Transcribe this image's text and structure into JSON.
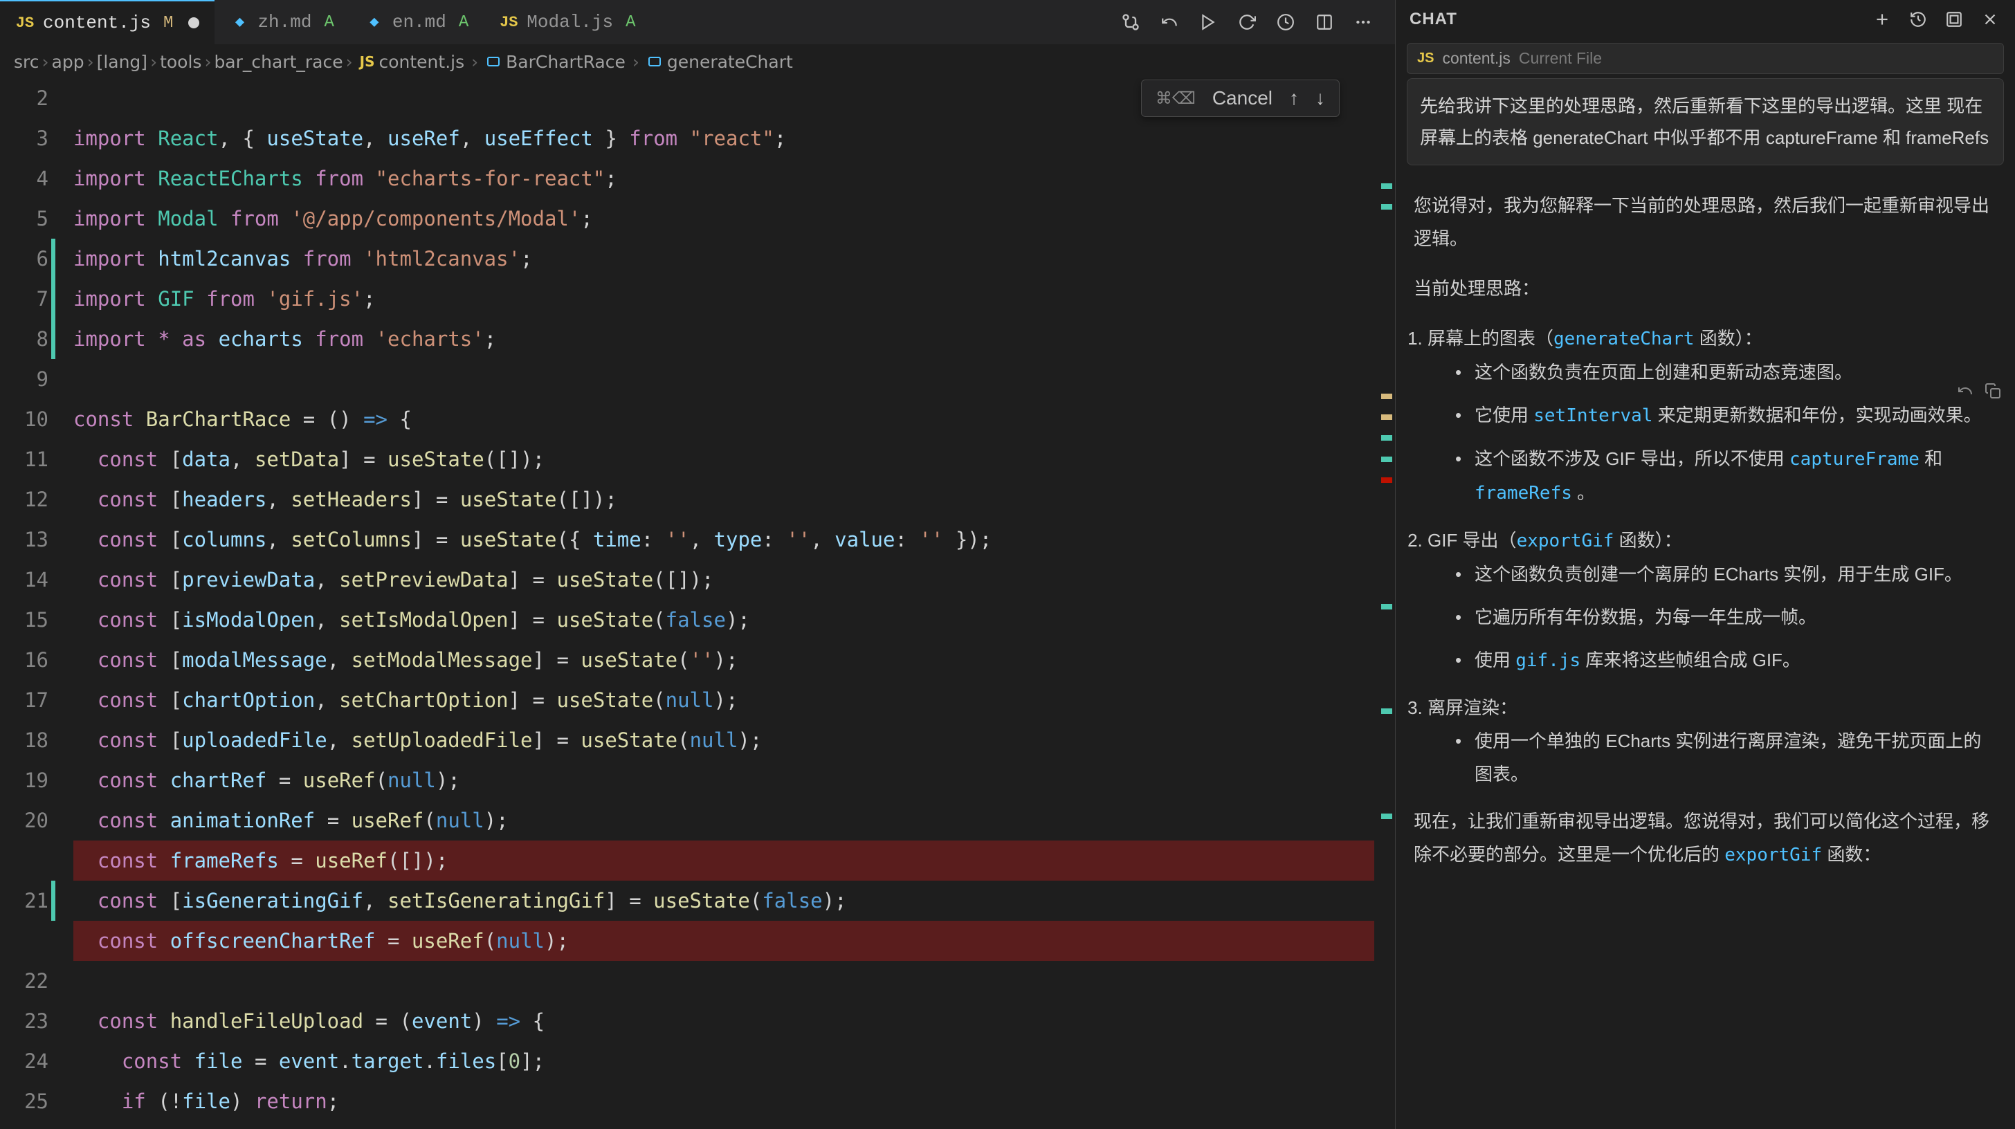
{
  "tabs": [
    {
      "name": "content.js",
      "status": "M",
      "active": true,
      "icon": "js"
    },
    {
      "name": "zh.md",
      "status": "A",
      "active": false,
      "icon": "md"
    },
    {
      "name": "en.md",
      "status": "A",
      "active": false,
      "icon": "md"
    },
    {
      "name": "Modal.js",
      "status": "A",
      "active": false,
      "icon": "js"
    }
  ],
  "breadcrumb": {
    "parts": [
      "src",
      "app",
      "[lang]",
      "tools",
      "bar_chart_race"
    ],
    "file": "content.js",
    "symbols": [
      "BarChartRace",
      "generateChart"
    ]
  },
  "find_widget": {
    "shortcut": "⌘⌫",
    "label": "Cancel"
  },
  "code_lines": [
    {
      "n": 2,
      "html": ""
    },
    {
      "n": 3,
      "html": "<span class='kw'>import</span> <span class='type'>React</span><span class='punc'>,</span> <span class='punc'>{</span> <span class='var'>useState</span><span class='punc'>,</span> <span class='var'>useRef</span><span class='punc'>,</span> <span class='var'>useEffect</span> <span class='punc'>}</span> <span class='kw'>from</span> <span class='str'>\"react\"</span><span class='punc'>;</span>"
    },
    {
      "n": 4,
      "html": "<span class='kw'>import</span> <span class='type'>ReactECharts</span> <span class='kw'>from</span> <span class='str'>\"echarts-for-react\"</span><span class='punc'>;</span>"
    },
    {
      "n": 5,
      "html": "<span class='kw'>import</span> <span class='type'>Modal</span> <span class='kw'>from</span> <span class='str'>'@/app/components/Modal'</span><span class='punc'>;</span>"
    },
    {
      "n": 6,
      "mod": true,
      "html": "<span class='kw'>import</span> <span class='var'>html2canvas</span> <span class='kw'>from</span> <span class='str'>'html2canvas'</span><span class='punc'>;</span>"
    },
    {
      "n": 7,
      "mod": true,
      "html": "<span class='kw'>import</span> <span class='type'>GIF</span> <span class='kw'>from</span> <span class='str'>'gif.js'</span><span class='punc'>;</span>"
    },
    {
      "n": 8,
      "mod": true,
      "html": "<span class='kw'>import</span> <span class='star'>*</span> <span class='kw'>as</span> <span class='var'>echarts</span> <span class='kw'>from</span> <span class='str'>'echarts'</span><span class='punc'>;</span>"
    },
    {
      "n": 9,
      "html": ""
    },
    {
      "n": 10,
      "html": "<span class='kw'>const</span> <span class='fn'>BarChartRace</span> <span class='op'>=</span> <span class='punc'>()</span> <span class='arrow'>=&gt;</span> <span class='punc'>{</span>"
    },
    {
      "n": 11,
      "html": "  <span class='kw'>const</span> <span class='punc'>[</span><span class='var'>data</span><span class='punc'>,</span> <span class='fn'>setData</span><span class='punc'>]</span> <span class='op'>=</span> <span class='fn'>useState</span><span class='punc'>([]);</span>"
    },
    {
      "n": 12,
      "html": "  <span class='kw'>const</span> <span class='punc'>[</span><span class='var'>headers</span><span class='punc'>,</span> <span class='fn'>setHeaders</span><span class='punc'>]</span> <span class='op'>=</span> <span class='fn'>useState</span><span class='punc'>([]);</span>"
    },
    {
      "n": 13,
      "html": "  <span class='kw'>const</span> <span class='punc'>[</span><span class='var'>columns</span><span class='punc'>,</span> <span class='fn'>setColumns</span><span class='punc'>]</span> <span class='op'>=</span> <span class='fn'>useState</span><span class='punc'>({ </span><span class='var'>time</span><span class='punc'>:</span> <span class='str'>''</span><span class='punc'>,</span> <span class='var'>type</span><span class='punc'>:</span> <span class='str'>''</span><span class='punc'>,</span> <span class='var'>value</span><span class='punc'>:</span> <span class='str'>''</span> <span class='punc'>});</span>"
    },
    {
      "n": 14,
      "html": "  <span class='kw'>const</span> <span class='punc'>[</span><span class='var'>previewData</span><span class='punc'>,</span> <span class='fn'>setPreviewData</span><span class='punc'>]</span> <span class='op'>=</span> <span class='fn'>useState</span><span class='punc'>([]);</span>"
    },
    {
      "n": 15,
      "html": "  <span class='kw'>const</span> <span class='punc'>[</span><span class='var'>isModalOpen</span><span class='punc'>,</span> <span class='fn'>setIsModalOpen</span><span class='punc'>]</span> <span class='op'>=</span> <span class='fn'>useState</span><span class='punc'>(</span><span class='bool'>false</span><span class='punc'>);</span>"
    },
    {
      "n": 16,
      "html": "  <span class='kw'>const</span> <span class='punc'>[</span><span class='var'>modalMessage</span><span class='punc'>,</span> <span class='fn'>setModalMessage</span><span class='punc'>]</span> <span class='op'>=</span> <span class='fn'>useState</span><span class='punc'>(</span><span class='str'>''</span><span class='punc'>);</span>"
    },
    {
      "n": 17,
      "html": "  <span class='kw'>const</span> <span class='punc'>[</span><span class='var'>chartOption</span><span class='punc'>,</span> <span class='fn'>setChartOption</span><span class='punc'>]</span> <span class='op'>=</span> <span class='fn'>useState</span><span class='punc'>(</span><span class='bool'>null</span><span class='punc'>);</span>"
    },
    {
      "n": 18,
      "html": "  <span class='kw'>const</span> <span class='punc'>[</span><span class='var'>uploadedFile</span><span class='punc'>,</span> <span class='fn'>setUploadedFile</span><span class='punc'>]</span> <span class='op'>=</span> <span class='fn'>useState</span><span class='punc'>(</span><span class='bool'>null</span><span class='punc'>);</span>"
    },
    {
      "n": 19,
      "html": "  <span class='kw'>const</span> <span class='var'>chartRef</span> <span class='op'>=</span> <span class='fn'>useRef</span><span class='punc'>(</span><span class='bool'>null</span><span class='punc'>);</span>"
    },
    {
      "n": 20,
      "html": "  <span class='kw'>const</span> <span class='var'>animationRef</span> <span class='op'>=</span> <span class='fn'>useRef</span><span class='punc'>(</span><span class='bool'>null</span><span class='punc'>);</span>"
    },
    {
      "n": null,
      "del": true,
      "html": "  <span class='kw'>const</span> <span class='var'>frameRefs</span> <span class='op'>=</span> <span class='fn'>useRef</span><span class='punc'>([]);</span>"
    },
    {
      "n": 21,
      "mod": true,
      "html": "  <span class='kw'>const</span> <span class='punc'>[</span><span class='var'>isGeneratingGif</span><span class='punc'>,</span> <span class='fn'>setIsGeneratingGif</span><span class='punc'>]</span> <span class='op'>=</span> <span class='fn'>useState</span><span class='punc'>(</span><span class='bool'>false</span><span class='punc'>);</span>"
    },
    {
      "n": null,
      "del": true,
      "html": "  <span class='kw'>const</span> <span class='var'>offscreenChartRef</span> <span class='op'>=</span> <span class='fn'>useRef</span><span class='punc'>(</span><span class='bool'>null</span><span class='punc'>);</span>"
    },
    {
      "n": 22,
      "html": ""
    },
    {
      "n": 23,
      "html": "  <span class='kw'>const</span> <span class='fn'>handleFileUpload</span> <span class='op'>=</span> <span class='punc'>(</span><span class='var'>event</span><span class='punc'>)</span> <span class='arrow'>=&gt;</span> <span class='punc'>{</span>"
    },
    {
      "n": 24,
      "html": "    <span class='kw'>const</span> <span class='var'>file</span> <span class='op'>=</span> <span class='var'>event</span><span class='punc'>.</span><span class='var'>target</span><span class='punc'>.</span><span class='var'>files</span><span class='punc'>[</span><span class='num'>0</span><span class='punc'>];</span>"
    },
    {
      "n": 25,
      "html": "    <span class='kw'>if</span> <span class='punc'>(!</span><span class='var'>file</span><span class='punc'>)</span> <span class='kw'>return</span><span class='punc'>;</span>"
    }
  ],
  "chat": {
    "title": "CHAT",
    "context_file": "content.js",
    "context_label": "Current File",
    "user_message": "先给我讲下这里的处理思路，然后重新看下这里的导出逻辑。这里 现在屏幕上的表格 generateChart 中似乎都不用 captureFrame 和 frameRefs",
    "reply_intro": "您说得对，我为您解释一下当前的处理思路，然后我们一起重新审视导出逻辑。",
    "heading_current": "当前处理思路：",
    "sec1_title": "屏幕上的图表（",
    "sec1_code": "generateChart",
    "sec1_title_after": " 函数）：",
    "sec1_b1": "这个函数负责在页面上创建和更新动态竞速图。",
    "sec1_b2_before": "它使用 ",
    "sec1_b2_code": "setInterval",
    "sec1_b2_after": " 来定期更新数据和年份，实现动画效果。",
    "sec1_b3_before": "这个函数不涉及 GIF 导出，所以不使用 ",
    "sec1_b3_code1": "captureFrame",
    "sec1_b3_mid": " 和 ",
    "sec1_b3_code2": "frameRefs",
    "sec1_b3_after": " 。",
    "sec2_title_before": "GIF 导出（",
    "sec2_code": "exportGif",
    "sec2_title_after": " 函数）：",
    "sec2_b1": "这个函数负责创建一个离屏的 ECharts 实例，用于生成 GIF。",
    "sec2_b2": "它遍历所有年份数据，为每一年生成一帧。",
    "sec2_b3_before": "使用 ",
    "sec2_b3_code": "gif.js",
    "sec2_b3_after": " 库来将这些帧组合成 GIF。",
    "sec3_title": "离屏渲染：",
    "sec3_b1": "使用一个单独的 ECharts 实例进行离屏渲染，避免干扰页面上的图表。",
    "closing_before": "现在，让我们重新审视导出逻辑。您说得对，我们可以简化这个过程，移除不必要的部分。这里是一个优化后的 ",
    "closing_code": "exportGif",
    "closing_after": " 函数："
  }
}
